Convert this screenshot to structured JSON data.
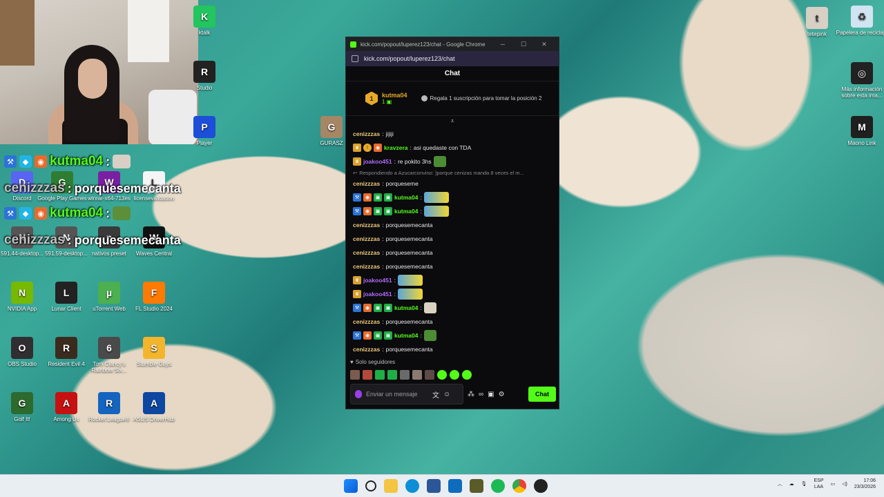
{
  "overlay": {
    "rows": [
      {
        "user": "kutma04",
        "sep": ":",
        "msg": ""
      },
      {
        "user": "cenizzzas",
        "sep": ":",
        "msg": "porquesemecanta"
      },
      {
        "user": "kutma04",
        "sep": ":",
        "msg": ""
      },
      {
        "user": "cenizzzas",
        "sep": ":",
        "msg": "porquesemecanta"
      }
    ]
  },
  "desktop_icons": [
    {
      "label": "ktalk",
      "color": "#22c55e",
      "glyph": "K"
    },
    {
      "label": "Studio",
      "color": "#222222",
      "glyph": "R"
    },
    {
      "label": "Player",
      "color": "#1d4ed8",
      "glyph": "P"
    },
    {
      "label": "Discord",
      "color": "#5865f2",
      "glyph": "D"
    },
    {
      "label": "Google Play Games",
      "color": "#2e7d32",
      "glyph": "G"
    },
    {
      "label": "winrar-x64-713es",
      "color": "#7b1fa2",
      "glyph": "W"
    },
    {
      "label": "licensevalidation",
      "color": "#f5f5f5",
      "glyph": "L"
    },
    {
      "label": "591.44-desktop...",
      "color": "#555555",
      "glyph": "N"
    },
    {
      "label": "591.59-desktop...",
      "color": "#555555",
      "glyph": "N"
    },
    {
      "label": "nativos preset",
      "color": "#3a3a3a",
      "glyph": "n"
    },
    {
      "label": "Waves Central",
      "color": "#111111",
      "glyph": "W"
    },
    {
      "label": "NVIDIA App",
      "color": "#76b900",
      "glyph": "N"
    },
    {
      "label": "Lunar Client",
      "color": "#222222",
      "glyph": "L"
    },
    {
      "label": "uTorrent Web",
      "color": "#4caf50",
      "glyph": "µ"
    },
    {
      "label": "FL Studio 2024",
      "color": "#ff7a00",
      "glyph": "F"
    },
    {
      "label": "OBS Studio",
      "color": "#302e31",
      "glyph": "O"
    },
    {
      "label": "Resident Evil 4",
      "color": "#3b2b1f",
      "glyph": "R"
    },
    {
      "label": "Tom Clancy's Rainbow Six...",
      "color": "#4a4a4a",
      "glyph": "6"
    },
    {
      "label": "Stumble Guys",
      "color": "#f3b52c",
      "glyph": "S"
    },
    {
      "label": "Golf It!",
      "color": "#2d6a2d",
      "glyph": "G"
    },
    {
      "label": "Among Us",
      "color": "#c51111",
      "glyph": "A"
    },
    {
      "label": "Rocket League®",
      "color": "#1565c0",
      "glyph": "R"
    },
    {
      "label": "ASUS DriverHub",
      "color": "#0d47a1",
      "glyph": "A"
    },
    {
      "label": "GURASZ",
      "color": "#a58766",
      "glyph": "G"
    },
    {
      "label": "tetepink",
      "color": "#d8cfc5",
      "glyph": "t"
    },
    {
      "label": "Papelera de reciclaje",
      "color": "#d0e4f2",
      "glyph": "♻"
    },
    {
      "label": "Más información sobre esta ima...",
      "color": "#222222",
      "glyph": "◎"
    },
    {
      "label": "Maono Link",
      "color": "#1f1f1f",
      "glyph": "M"
    }
  ],
  "browser": {
    "title": "kick.com/popout/luperez123/chat - Google Chrome",
    "url": "kick.com/popout/luperez123/chat",
    "controls": {
      "minimize": "─",
      "maximize": "☐",
      "close": "✕"
    }
  },
  "chat": {
    "header": "Chat",
    "pinned": {
      "rank": "1",
      "user": "kutma04",
      "count": "1",
      "gift_text": "Regala 1 suscripción para tomar la posición 2"
    },
    "messages": [
      {
        "user": "cenizzzas",
        "color": "#f0c87a",
        "text": "jijiji",
        "badges": []
      },
      {
        "user": "kravzera",
        "color": "#53fc18",
        "text": "asi quedaste con TDA",
        "badges": [
          "gold",
          "circ",
          "orange"
        ]
      },
      {
        "user": "joakoo451",
        "color": "#b26bff",
        "text": "re pokito 3hs",
        "badges": [
          "gold"
        ],
        "emote": "frog"
      },
      {
        "reply": "Respondiendo a Azucarconvino: }porque cenizas manda 8 veces el m..."
      },
      {
        "user": "cenizzzas",
        "color": "#f0c87a",
        "text": "porqueseme",
        "badges": []
      },
      {
        "user": "kutma04",
        "color": "#53fc18",
        "text": "",
        "badges": [
          "blue",
          "orange",
          "green",
          "green"
        ],
        "emote": "wide"
      },
      {
        "user": "kutma04",
        "color": "#53fc18",
        "text": "",
        "badges": [
          "blue",
          "orange",
          "green",
          "green"
        ],
        "emote": "wide"
      },
      {
        "user": "cenizzzas",
        "color": "#f0c87a",
        "text": "porquesemecanta",
        "badges": []
      },
      {
        "user": "cenizzzas",
        "color": "#f0c87a",
        "text": "porquesemecanta",
        "badges": []
      },
      {
        "user": "cenizzzas",
        "color": "#f0c87a",
        "text": "porquesemecanta",
        "badges": []
      },
      {
        "user": "cenizzzas",
        "color": "#f0c87a",
        "text": "porquesemecanta",
        "badges": []
      },
      {
        "user": "joakoo451",
        "color": "#b26bff",
        "text": "",
        "badges": [
          "gold"
        ],
        "emote": "wide"
      },
      {
        "user": "joakoo451",
        "color": "#b26bff",
        "text": "",
        "badges": [
          "gold"
        ],
        "emote": "wide"
      },
      {
        "user": "kutma04",
        "color": "#53fc18",
        "text": "",
        "badges": [
          "blue",
          "orange",
          "green",
          "green"
        ],
        "emote": "cat"
      },
      {
        "user": "cenizzzas",
        "color": "#f0c87a",
        "text": "porquesemecanta",
        "badges": []
      },
      {
        "user": "kutma04",
        "color": "#53fc18",
        "text": "",
        "badges": [
          "blue",
          "orange",
          "green",
          "green"
        ],
        "emote": "frog"
      },
      {
        "user": "cenizzzas",
        "color": "#f0c87a",
        "text": "porquesemecanta",
        "badges": []
      }
    ],
    "followers_only": "Solo seguidores",
    "input_placeholder": "Enviar un mensaje",
    "send_label": "Chat"
  },
  "taskbar": {
    "lang_top": "ESP",
    "lang_bottom": "LAA",
    "time": "17:06",
    "date": "23/3/2026"
  }
}
